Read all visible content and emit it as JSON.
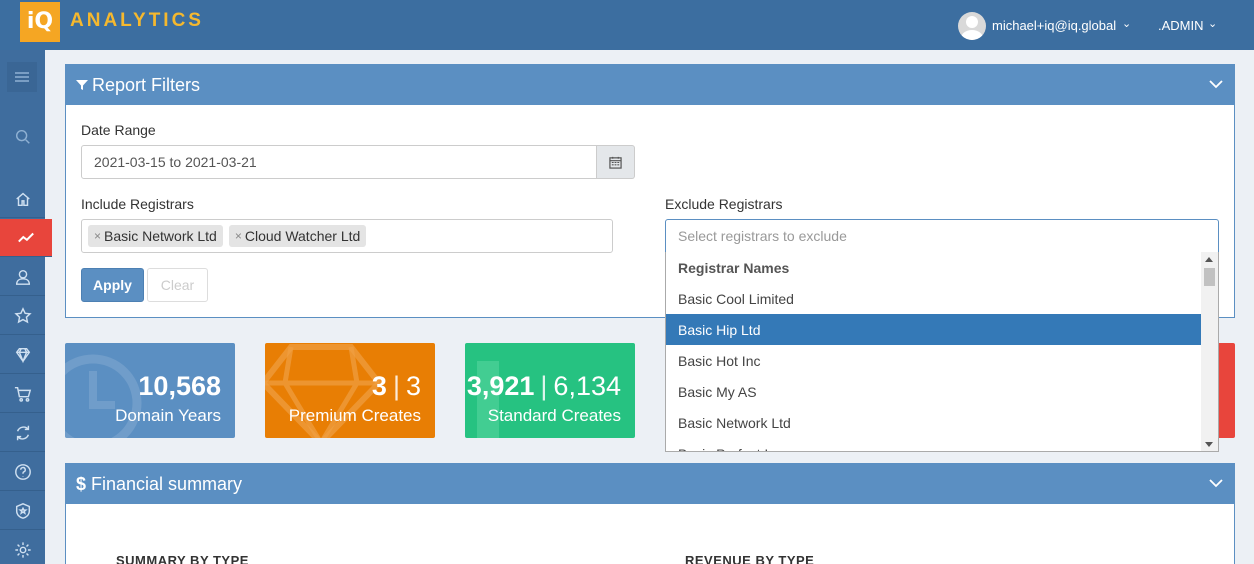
{
  "header": {
    "logo_mark": "iQ",
    "app_title": "ANALYTICS",
    "user_email": "michael+iq@iq.global",
    "role": ".ADMIN"
  },
  "sidebar": {
    "items": [
      {
        "icon": "search-icon"
      },
      {
        "icon": "home-icon"
      },
      {
        "icon": "trend-chart-icon",
        "active": true
      },
      {
        "icon": "user-icon"
      },
      {
        "icon": "star-icon"
      },
      {
        "icon": "diamond-icon"
      },
      {
        "icon": "cart-icon"
      },
      {
        "icon": "refresh-icon"
      },
      {
        "icon": "help-icon"
      },
      {
        "icon": "shield-icon"
      },
      {
        "icon": "settings-icon"
      }
    ]
  },
  "filters": {
    "title": "Report Filters",
    "date_label": "Date Range",
    "date_value": "2021-03-15 to 2021-03-21",
    "include_label": "Include Registrars",
    "include_tags": [
      "Basic Network Ltd",
      "Cloud Watcher Ltd"
    ],
    "exclude_label": "Exclude Registrars",
    "exclude_placeholder": "Select registrars to exclude",
    "apply_label": "Apply",
    "clear_label": "Clear"
  },
  "exclude_dropdown": {
    "group_label": "Registrar Names",
    "options": [
      "Basic Cool Limited",
      "Basic Hip Ltd",
      "Basic Hot Inc",
      "Basic My AS",
      "Basic Network Ltd",
      "Basic Perfect Inc"
    ],
    "highlighted": "Basic Hip Ltd"
  },
  "stats": [
    {
      "primary": "10,568",
      "secondary": "",
      "caption": "Domain Years",
      "color": "#5b8fc2"
    },
    {
      "primary": "3",
      "secondary": "3",
      "caption": "Premium Creates",
      "color": "#e87e04"
    },
    {
      "primary": "3,921",
      "secondary": "6,134",
      "caption": "Standard Creates",
      "color": "#26c281"
    }
  ],
  "financial": {
    "title": "Financial summary",
    "summary_heading": "SUMMARY BY TYPE",
    "revenue_heading": "REVENUE BY TYPE"
  },
  "colors": {
    "topbar": "#3c6ea0",
    "panel": "#5b8fc2",
    "active_nav": "#e8453c",
    "selected_option": "#3479b7"
  }
}
